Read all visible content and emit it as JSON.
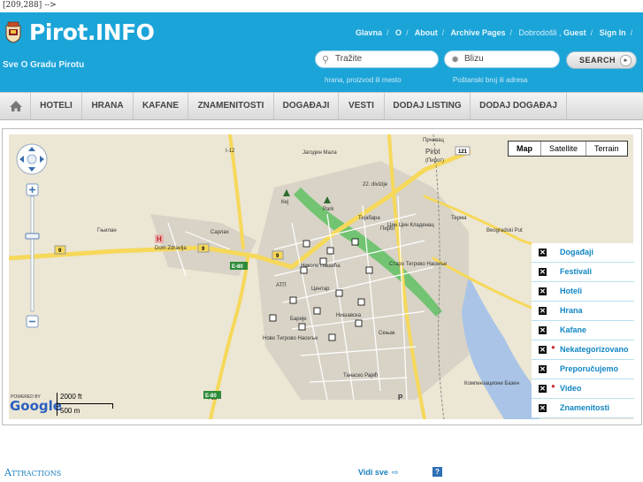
{
  "stray_text": "[209,288] -->",
  "header": {
    "logo": "Pirot.INFO",
    "tagline": "Sve O Gradu Pirotu",
    "topnav": {
      "items": [
        "Glavna",
        "O",
        "About",
        "Archive Pages"
      ],
      "welcome": "Dobrodošli ,",
      "guest": "Guest",
      "signin": "Sign In"
    },
    "search": {
      "query_placeholder": "Tražite",
      "location_placeholder": "Blizu",
      "query_hint": "hrana, proizvod ili mesto",
      "location_hint": "Poštanski broj ili adresa",
      "button": "SEARCH"
    }
  },
  "nav": {
    "items": [
      "HOTELI",
      "HRANA",
      "KAFANE",
      "ZNAMENITOSTI",
      "DOGAĐAJI",
      "VESTI",
      "DODAJ LISTING",
      "DODAJ DOGAĐAJ"
    ]
  },
  "map": {
    "types": [
      "Map",
      "Satellite",
      "Terrain"
    ],
    "active_type": "Map",
    "scale_ft": "2000 ft",
    "scale_m": "500 m",
    "powered_by": "POWERED BY",
    "google": "Google",
    "labels": {
      "pirot": "Pirot",
      "pirot_cyr": "(Пирот)",
      "pirot_district": "Пирот",
      "road_121": "121",
      "road_9a": "9",
      "road_9b": "9",
      "road_9c": "9",
      "e80a": "E-80",
      "e80b": "E-80",
      "jagodin": "Јагодин Мала",
      "kej": "Кеј",
      "park": "Park",
      "tijabara": "Тијабара",
      "cin_cin": "Цин Цин Кладенац",
      "staro_tigrovo": "Старо Тигрово Насеље",
      "gnjilan": "Гњилан",
      "dom_zdravlja": "Dom Zdravlja",
      "sarlah": "Сарлах",
      "centar": "Центар",
      "barije": "Барије",
      "novo_tigrovo": "Ново Тигрово Насеље",
      "senjak": "Сењак",
      "tanasko_rajic": "Танаско Рајић",
      "kompenzacioni": "Компензациони Базен",
      "atp": "АТП",
      "i12": "I-12",
      "i12b": "I-12",
      "road_22": "22. divizije",
      "beogradski_put": "Beogradski Put",
      "nishavska": "Нишавска",
      "terma": "Терма",
      "nikole": "Николе Пашића",
      "prichevac": "Прчевац",
      "hospital": "H",
      "p": "P"
    },
    "categories": [
      {
        "label": "Događaji",
        "pin": false
      },
      {
        "label": "Festivali",
        "pin": false
      },
      {
        "label": "Hoteli",
        "pin": false
      },
      {
        "label": "Hrana",
        "pin": false
      },
      {
        "label": "Kafane",
        "pin": false
      },
      {
        "label": "Nekategorizovano",
        "pin": true
      },
      {
        "label": "Preporučujemo",
        "pin": false
      },
      {
        "label": "Video",
        "pin": true
      },
      {
        "label": "Znamenitosti",
        "pin": false
      }
    ],
    "colors": {
      "land": "#ece6d4",
      "highway": "#f6d85a",
      "river_green": "#72c472",
      "water": "#a9c4e6"
    }
  },
  "footer": {
    "section_title": "Attractions",
    "see_all": "Vidi sve",
    "help": "?"
  }
}
